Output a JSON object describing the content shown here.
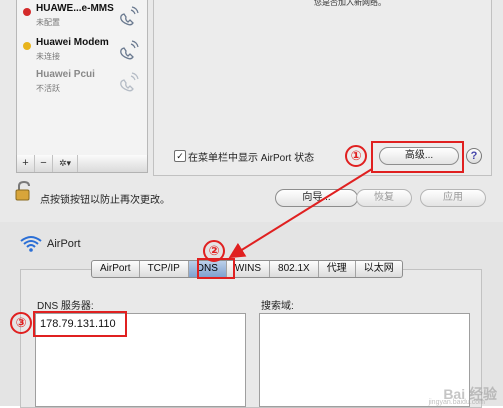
{
  "network_prefs": {
    "services": [
      {
        "name": "HUAWE...e-MMS",
        "status": "未配置",
        "dot_color": "#d42a2a"
      },
      {
        "name": "Huawei Modem",
        "status": "未连接",
        "dot_color": "#e8b41c"
      },
      {
        "name": "Huawei Pcui",
        "status": "不活跃",
        "dot_color": null
      }
    ],
    "toolbar": {
      "add": "+",
      "remove": "−",
      "gear": "✲▾"
    },
    "detail_hint": "您是否加入新网络。",
    "menubar_checkbox": {
      "checked": true,
      "label": "在菜单栏中显示 AirPort 状态"
    },
    "advanced_button": "高级...",
    "help_button": "?",
    "lock_text": "点按锁按钮以防止再次更改。",
    "assist_button": "向导...",
    "revert_button": "恢复",
    "apply_button": "应用"
  },
  "advanced": {
    "title": "AirPort",
    "tabs": [
      "AirPort",
      "TCP/IP",
      "DNS",
      "WINS",
      "802.1X",
      "代理",
      "以太网"
    ],
    "active_tab": "DNS",
    "dns_servers_label": "DNS 服务器:",
    "dns_servers": [
      "178.79.131.110"
    ],
    "search_domains_label": "搜索域:"
  },
  "annotations": {
    "step1": "①",
    "step2": "②",
    "step3": "③",
    "color": "#e02020"
  },
  "watermark": {
    "text": "Bai 经验",
    "sub": "jingyan.baidu.com"
  }
}
